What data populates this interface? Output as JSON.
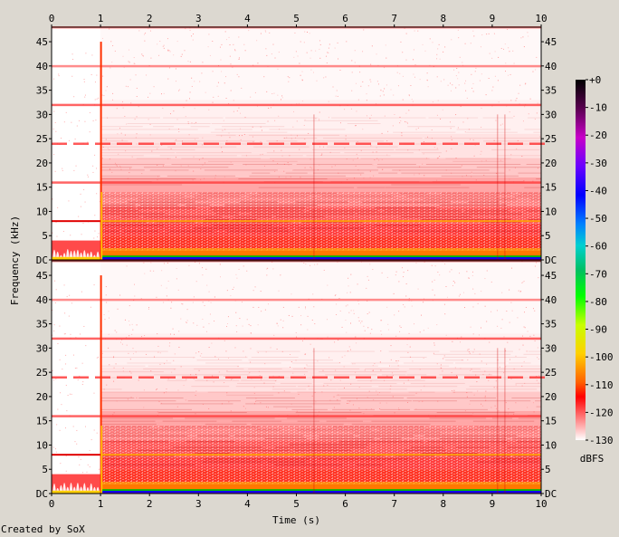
{
  "footer": {
    "credit": "Created by SoX"
  },
  "chart_data": {
    "type": "heatmap",
    "title": "",
    "xlabel": "Time (s)",
    "ylabel": "Frequency (kHz)",
    "xlim": [
      0,
      10
    ],
    "ylim": [
      0,
      48
    ],
    "x_ticks": [
      "0",
      "1",
      "2",
      "3",
      "4",
      "5",
      "6",
      "7",
      "8",
      "9",
      "10"
    ],
    "y_ticks": [
      "DC",
      "5",
      "10",
      "15",
      "20",
      "25",
      "30",
      "35",
      "40",
      "45"
    ],
    "channels": 2,
    "colorbar": {
      "label": "dBFS",
      "ticks": [
        "+0",
        "-10",
        "-20",
        "-30",
        "-40",
        "-50",
        "-60",
        "-70",
        "-80",
        "-90",
        "-100",
        "-110",
        "-120",
        "-130"
      ],
      "range": [
        -130,
        0
      ]
    },
    "features": {
      "onset_time": 1.0,
      "tonal_lines_khz": [
        8,
        16,
        24,
        32,
        40,
        48
      ],
      "transients_s": [
        5.35,
        9.1,
        9.25
      ]
    },
    "colors": {
      "background": "#dcd8d0",
      "plot_bg": "#ffffff",
      "noise_red": "#ff2a2a",
      "floor_yellow": "#ffd000",
      "low_band_purple": "#6000c8"
    }
  }
}
